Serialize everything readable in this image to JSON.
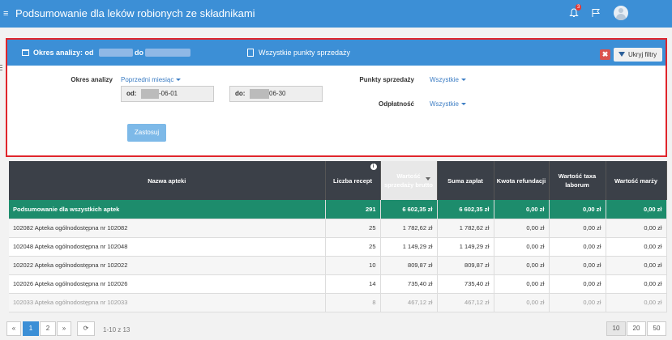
{
  "app": {
    "title": "Podsumowanie dla leków robionych ze składnikami",
    "notification_count": "3"
  },
  "filter_header": {
    "period_label": "Okres analizy: od",
    "period_to": "do",
    "points_label": "Wszystkie punkty sprzedaży",
    "close_symbol": "✖",
    "hide_label": "Ukryj filtry"
  },
  "filters": {
    "period_label": "Okres analizy",
    "period_value": "Poprzedni miesiąc",
    "from_label": "od:",
    "from_value": "-06-01",
    "to_label": "do:",
    "to_value": "06-30",
    "points_label": "Punkty sprzedaży",
    "points_value": "Wszystkie",
    "payment_label": "Odpłatność",
    "payment_value": "Wszystkie",
    "apply_label": "Zastosuj"
  },
  "table": {
    "headers": [
      "Nazwa apteki",
      "Liczba recept",
      "Wartość sprzedaży brutto",
      "Suma zapłat",
      "Kwota refundacji",
      "Wartość taxa laborum",
      "Wartość marży"
    ],
    "info_icon": "i",
    "summary": [
      "Podsumowanie dla wszystkich aptek",
      "291",
      "6 602,35 zł",
      "6 602,35 zł",
      "0,00 zł",
      "0,00 zł",
      "0,00 zł"
    ],
    "rows": [
      [
        "102082 Apteka ogólnodostępna nr 102082",
        "25",
        "1 782,62 zł",
        "1 782,62 zł",
        "0,00 zł",
        "0,00 zł",
        "0,00 zł"
      ],
      [
        "102048 Apteka ogólnodostępna nr 102048",
        "25",
        "1 149,29 zł",
        "1 149,29 zł",
        "0,00 zł",
        "0,00 zł",
        "0,00 zł"
      ],
      [
        "102022 Apteka ogólnodostępna nr 102022",
        "10",
        "809,87 zł",
        "809,87 zł",
        "0,00 zł",
        "0,00 zł",
        "0,00 zł"
      ],
      [
        "102026 Apteka ogólnodostępna nr 102026",
        "14",
        "735,40 zł",
        "735,40 zł",
        "0,00 zł",
        "0,00 zł",
        "0,00 zł"
      ],
      [
        "102033 Apteka ogólnodostępna nr 102033",
        "8",
        "467,12 zł",
        "467,12 zł",
        "0,00 zł",
        "0,00 zł",
        "0,00 zł"
      ]
    ]
  },
  "pager": {
    "prev": "«",
    "page1": "1",
    "page2": "2",
    "next": "»",
    "refresh": "⟳",
    "range": "1-10 z 13",
    "sizes": [
      "10",
      "20",
      "50"
    ]
  }
}
